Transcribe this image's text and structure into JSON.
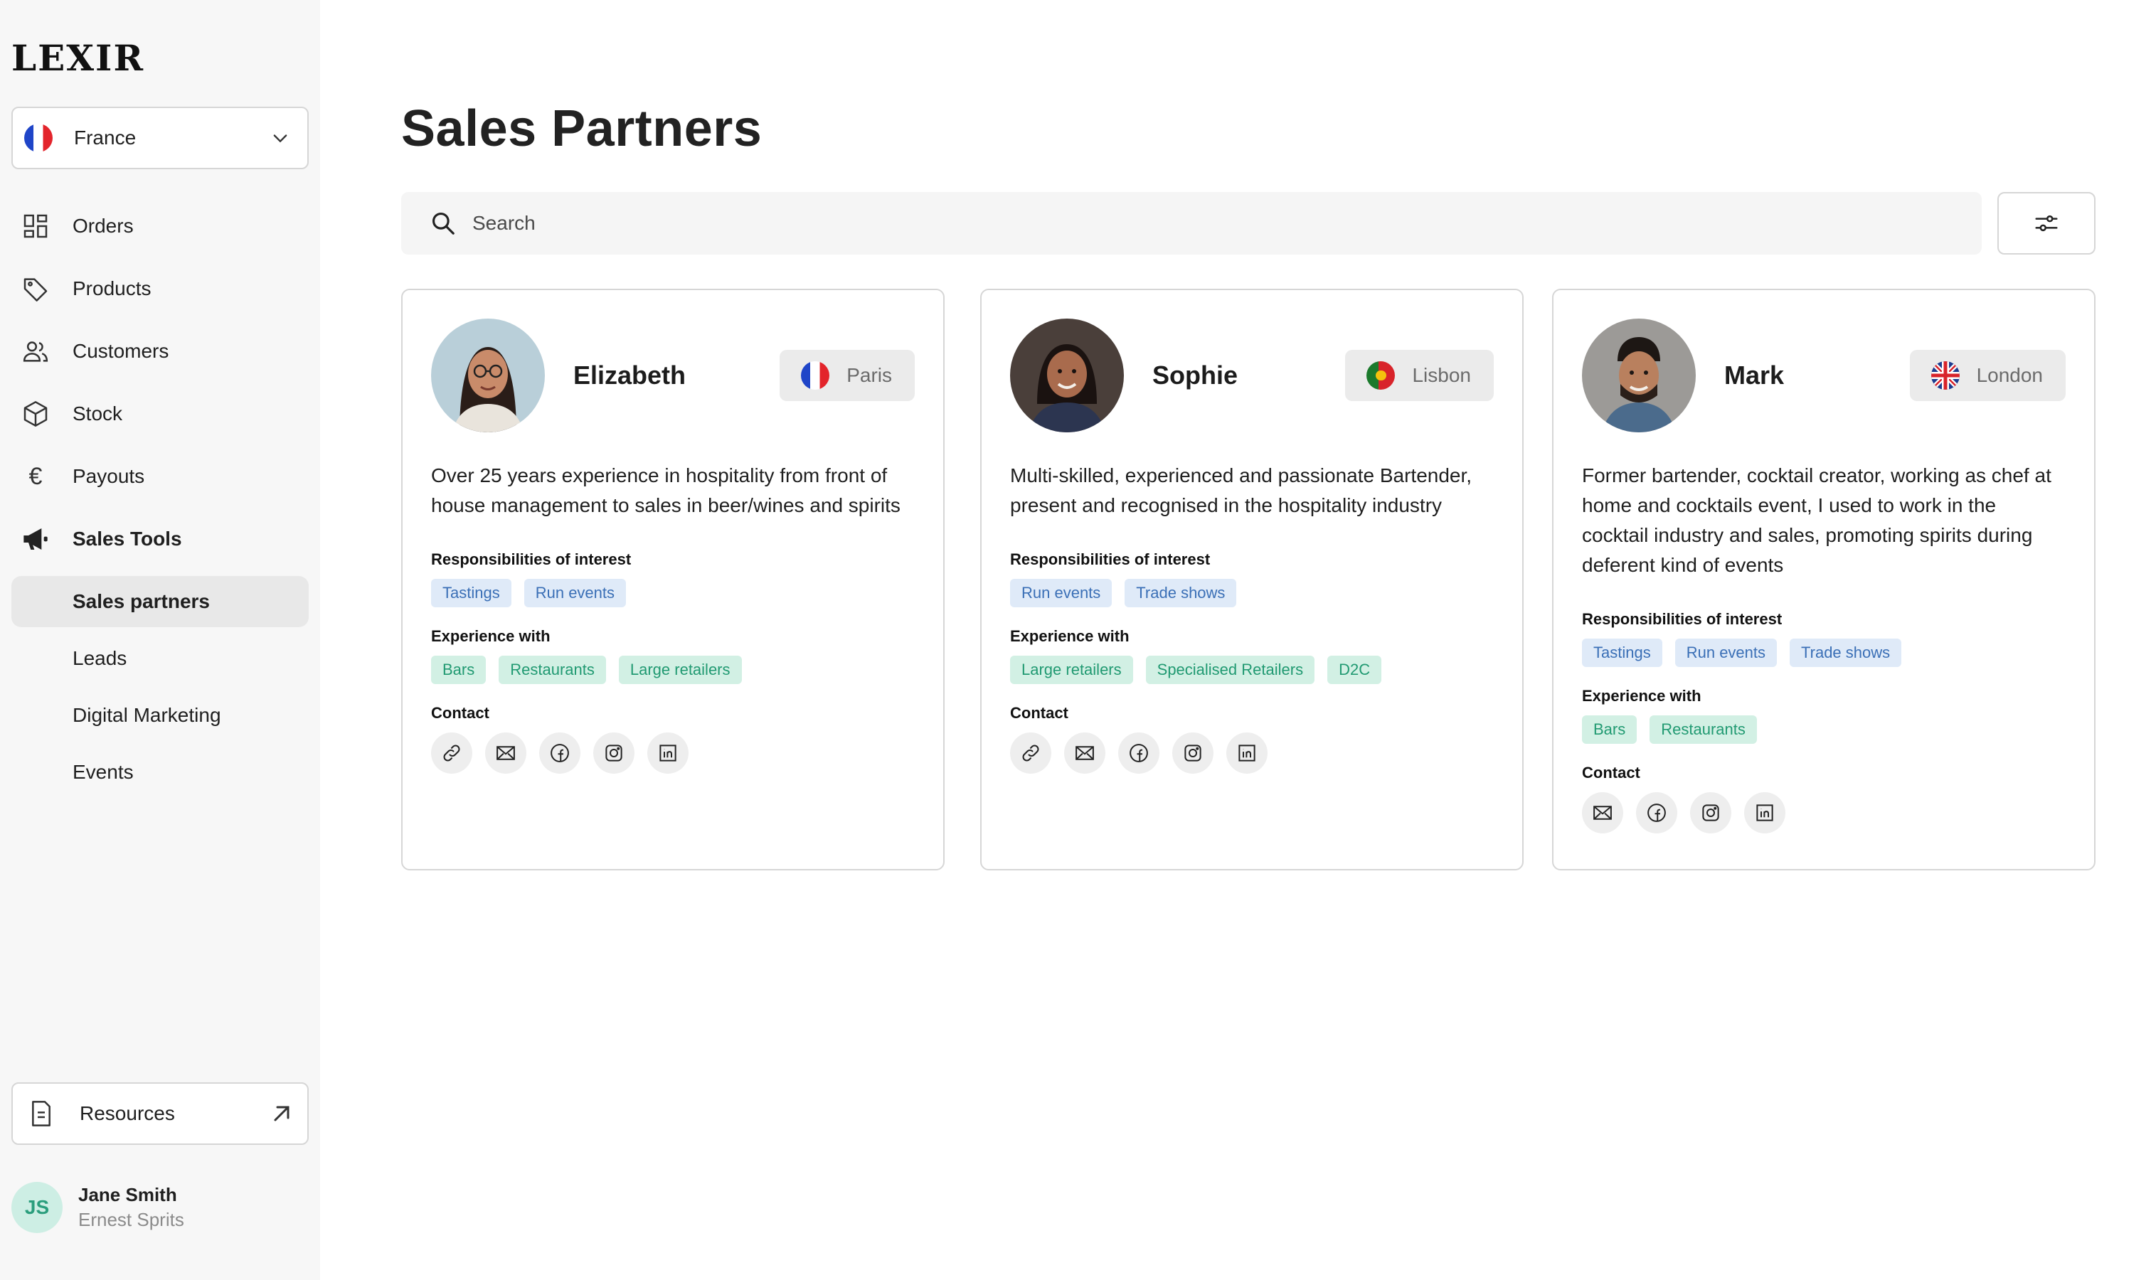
{
  "app": {
    "logo": "LEXIR"
  },
  "country_select": {
    "value": "France"
  },
  "nav": {
    "orders": "Orders",
    "products": "Products",
    "customers": "Customers",
    "stock": "Stock",
    "payouts": "Payouts",
    "sales_tools": "Sales Tools",
    "sub": {
      "sales_partners": "Sales partners",
      "leads": "Leads",
      "digital_marketing": "Digital Marketing",
      "events": "Events"
    }
  },
  "resources": {
    "label": "Resources"
  },
  "user": {
    "initials": "JS",
    "name": "Jane Smith",
    "org": "Ernest Sprits"
  },
  "page": {
    "title": "Sales Partners"
  },
  "search": {
    "placeholder": "Search"
  },
  "labels": {
    "responsibilities": "Responsibilities of interest",
    "experience": "Experience with",
    "contact": "Contact"
  },
  "colors": {
    "blue_tag_bg": "#dfeaf8",
    "blue_tag_text": "#3a6fb6",
    "green_tag_bg": "#d2f0e4",
    "green_tag_text": "#219a72",
    "avatar_bg": "#cdeee4",
    "avatar_text": "#2b9e7d"
  },
  "partners": [
    {
      "name": "Elizabeth",
      "city": "Paris",
      "flag": "france-flag-icon",
      "bio": "Over 25 years experience in hospitality from front of house management to sales in beer/wines and spirits",
      "responsibilities": [
        "Tastings",
        "Run events"
      ],
      "experience": [
        "Bars",
        "Restaurants",
        "Large retailers"
      ],
      "contacts": [
        "link-icon",
        "mail-icon",
        "facebook-icon",
        "instagram-icon",
        "linkedin-icon"
      ]
    },
    {
      "name": "Sophie",
      "city": "Lisbon",
      "flag": "portugal-flag-icon",
      "bio": "Multi-skilled, experienced and passionate Bartender, present and recognised in the hospitality industry",
      "responsibilities": [
        "Run events",
        "Trade shows"
      ],
      "experience": [
        "Large retailers",
        "Specialised Retailers",
        "D2C"
      ],
      "contacts": [
        "link-icon",
        "mail-icon",
        "facebook-icon",
        "instagram-icon",
        "linkedin-icon"
      ]
    },
    {
      "name": "Mark",
      "city": "London",
      "flag": "uk-flag-icon",
      "bio": "Former bartender, cocktail creator,  working as chef at home and cocktails event, I used to work in the cocktail industry and sales, promoting spirits during deferent kind of events",
      "responsibilities": [
        "Tastings",
        "Run events",
        "Trade shows"
      ],
      "experience": [
        "Bars",
        "Restaurants"
      ],
      "contacts": [
        "mail-icon",
        "facebook-icon",
        "instagram-icon",
        "linkedin-icon"
      ]
    }
  ]
}
